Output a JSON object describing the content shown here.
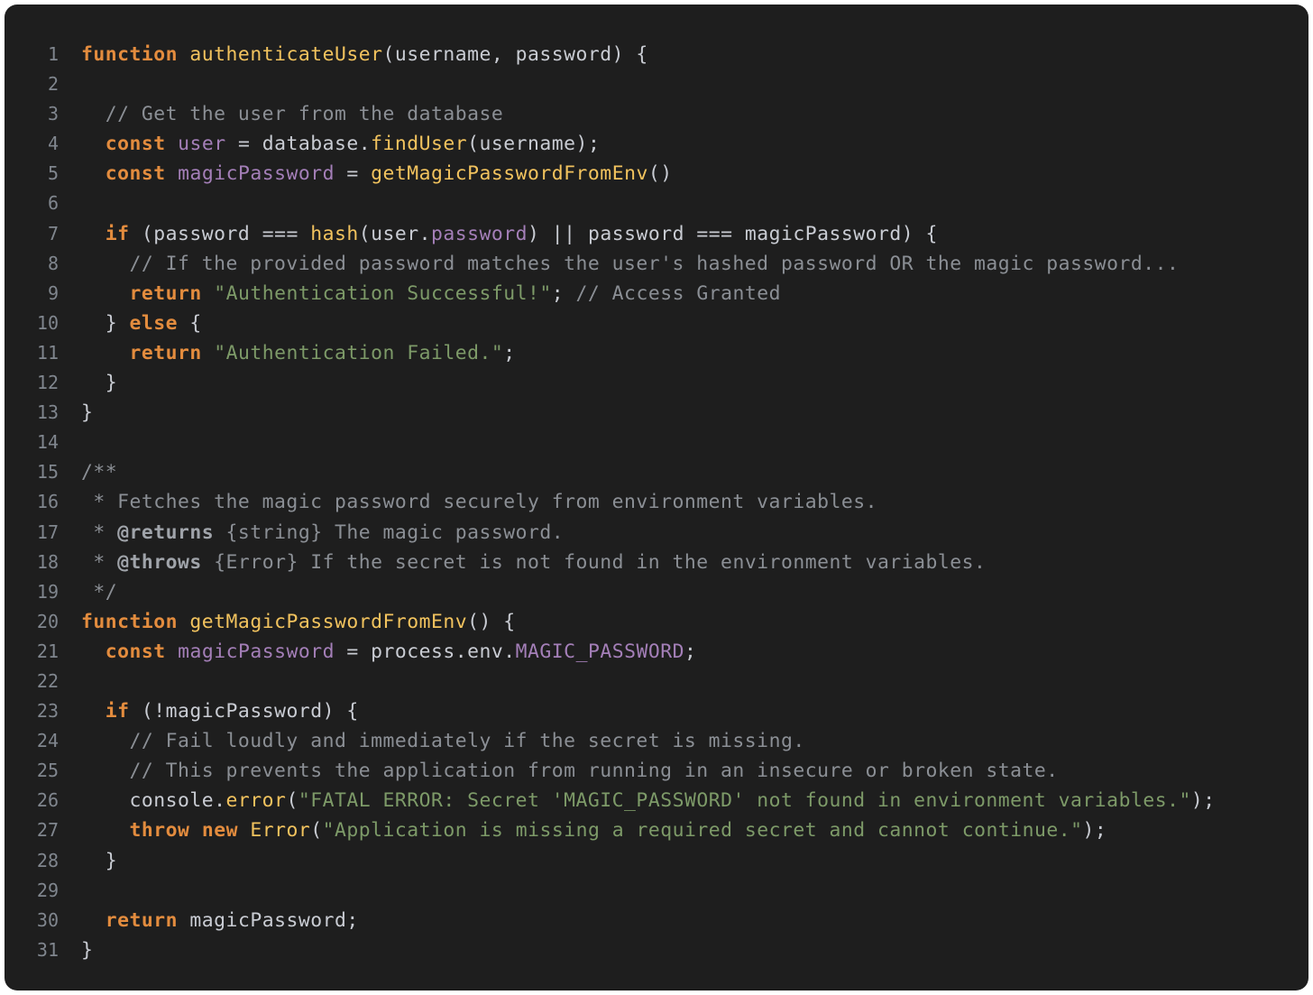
{
  "colors": {
    "background": "#1e1e1e",
    "keyword": "#e38c3e",
    "function": "#f2c35e",
    "variable": "#a47fb8",
    "string": "#7d9a68",
    "comment": "#8b8f95",
    "line_number": "#80868e",
    "text": "#c9ccd3"
  },
  "lines": [
    [
      [
        "kw",
        "function"
      ],
      [
        "pn",
        " "
      ],
      [
        "fn",
        "authenticateUser"
      ],
      [
        "pn",
        "(username, password) {"
      ]
    ],
    [],
    [
      [
        "pn",
        "  "
      ],
      [
        "cmt",
        "// Get the user from the database"
      ]
    ],
    [
      [
        "pn",
        "  "
      ],
      [
        "kw",
        "const"
      ],
      [
        "pn",
        " "
      ],
      [
        "var",
        "user"
      ],
      [
        "pn",
        " = database."
      ],
      [
        "fn",
        "findUser"
      ],
      [
        "pn",
        "(username);"
      ]
    ],
    [
      [
        "pn",
        "  "
      ],
      [
        "kw",
        "const"
      ],
      [
        "pn",
        " "
      ],
      [
        "var",
        "magicPassword"
      ],
      [
        "pn",
        " = "
      ],
      [
        "fn",
        "getMagicPasswordFromEnv"
      ],
      [
        "pn",
        "()"
      ]
    ],
    [],
    [
      [
        "pn",
        "  "
      ],
      [
        "kw",
        "if"
      ],
      [
        "pn",
        " (password === "
      ],
      [
        "fn",
        "hash"
      ],
      [
        "pn",
        "(user."
      ],
      [
        "var",
        "password"
      ],
      [
        "pn",
        ") || password === magicPassword) {"
      ]
    ],
    [
      [
        "pn",
        "    "
      ],
      [
        "cmt",
        "// If the provided password matches the user's hashed password OR the magic password..."
      ]
    ],
    [
      [
        "pn",
        "    "
      ],
      [
        "kw",
        "return"
      ],
      [
        "pn",
        " "
      ],
      [
        "str",
        "\"Authentication Successful!\""
      ],
      [
        "pn",
        "; "
      ],
      [
        "cmt",
        "// Access Granted"
      ]
    ],
    [
      [
        "pn",
        "  } "
      ],
      [
        "kw",
        "else"
      ],
      [
        "pn",
        " {"
      ]
    ],
    [
      [
        "pn",
        "    "
      ],
      [
        "kw",
        "return"
      ],
      [
        "pn",
        " "
      ],
      [
        "str",
        "\"Authentication Failed.\""
      ],
      [
        "pn",
        ";"
      ]
    ],
    [
      [
        "pn",
        "  }"
      ]
    ],
    [
      [
        "pn",
        "}"
      ]
    ],
    [],
    [
      [
        "cmt",
        "/**"
      ]
    ],
    [
      [
        "cmt",
        " * Fetches the magic password securely from environment variables."
      ]
    ],
    [
      [
        "cmt",
        " * "
      ],
      [
        "tag",
        "@returns"
      ],
      [
        "cmt",
        " {string} The magic password."
      ]
    ],
    [
      [
        "cmt",
        " * "
      ],
      [
        "tag",
        "@throws"
      ],
      [
        "cmt",
        " {Error} If the secret is not found in the environment variables."
      ]
    ],
    [
      [
        "cmt",
        " */"
      ]
    ],
    [
      [
        "kw",
        "function"
      ],
      [
        "pn",
        " "
      ],
      [
        "fn",
        "getMagicPasswordFromEnv"
      ],
      [
        "pn",
        "() {"
      ]
    ],
    [
      [
        "pn",
        "  "
      ],
      [
        "kw",
        "const"
      ],
      [
        "pn",
        " "
      ],
      [
        "var",
        "magicPassword"
      ],
      [
        "pn",
        " = process.env."
      ],
      [
        "var",
        "MAGIC_PASSWORD"
      ],
      [
        "pn",
        ";"
      ]
    ],
    [],
    [
      [
        "pn",
        "  "
      ],
      [
        "kw",
        "if"
      ],
      [
        "pn",
        " (!magicPassword) {"
      ]
    ],
    [
      [
        "pn",
        "    "
      ],
      [
        "cmt",
        "// Fail loudly and immediately if the secret is missing."
      ]
    ],
    [
      [
        "pn",
        "    "
      ],
      [
        "cmt",
        "// This prevents the application from running in an insecure or broken state."
      ]
    ],
    [
      [
        "pn",
        "    console."
      ],
      [
        "fn",
        "error"
      ],
      [
        "pn",
        "("
      ],
      [
        "str",
        "\"FATAL ERROR: Secret 'MAGIC_PASSWORD' not found in environment variables.\""
      ],
      [
        "pn",
        ");"
      ]
    ],
    [
      [
        "pn",
        "    "
      ],
      [
        "kw",
        "throw"
      ],
      [
        "pn",
        " "
      ],
      [
        "kw",
        "new"
      ],
      [
        "pn",
        " "
      ],
      [
        "cls",
        "Error"
      ],
      [
        "pn",
        "("
      ],
      [
        "str",
        "\"Application is missing a required secret and cannot continue.\""
      ],
      [
        "pn",
        ");"
      ]
    ],
    [
      [
        "pn",
        "  }"
      ]
    ],
    [],
    [
      [
        "pn",
        "  "
      ],
      [
        "kw",
        "return"
      ],
      [
        "pn",
        " magicPassword;"
      ]
    ],
    [
      [
        "pn",
        "}"
      ]
    ]
  ]
}
